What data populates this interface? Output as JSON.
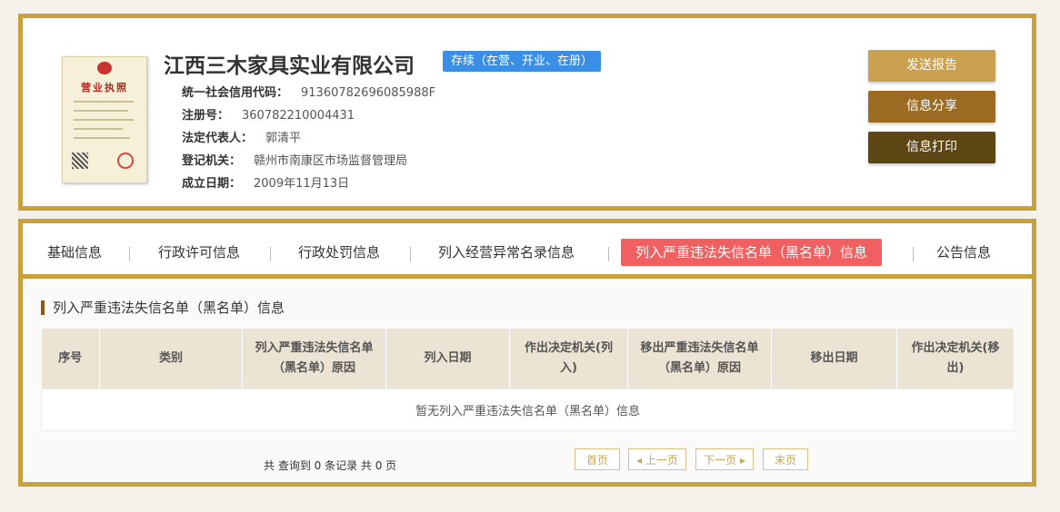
{
  "company": {
    "name": "江西三木家具实业有限公司",
    "status": "存续（在营、开业、在册）",
    "license_title": "营业执照",
    "info": [
      {
        "label": "统一社会信用代码：",
        "value": "91360782696085988F"
      },
      {
        "label": "注册号：",
        "value": "360782210004431"
      },
      {
        "label": "法定代表人：",
        "value": "郭清平"
      },
      {
        "label": "登记机关：",
        "value": "赣州市南康区市场监督管理局"
      },
      {
        "label": "成立日期：",
        "value": "2009年11月13日"
      }
    ]
  },
  "actions": {
    "send_report": "发送报告",
    "share": "信息分享",
    "print": "信息打印",
    "colors": [
      "#c9a150",
      "#9b6b24",
      "#5e4514"
    ]
  },
  "tabs": [
    {
      "label": "基础信息"
    },
    {
      "label": "行政许可信息"
    },
    {
      "label": "行政处罚信息"
    },
    {
      "label": "列入经营异常名录信息"
    },
    {
      "label": "列入严重违法失信名单（黑名单）信息",
      "active": true
    },
    {
      "label": "公告信息"
    }
  ],
  "section": {
    "title": "列入严重违法失信名单（黑名单）信息",
    "columns": [
      "序号",
      "类别",
      "列入严重违法失信名单（黑名单）原因",
      "列入日期",
      "作出决定机关(列入)",
      "移出严重违法失信名单（黑名单）原因",
      "移出日期",
      "作出决定机关(移出)"
    ],
    "empty_text": "暂无列入严重违法失信名单（黑名单）信息"
  },
  "pager": {
    "summary": "共 查询到 0 条记录 共 0 页",
    "first": "首页",
    "prev": "上一页",
    "next": "下一页",
    "last": "末页"
  },
  "theme": {
    "border": "#c9a13b",
    "active_tab": "#f06060",
    "badge": "#3a8ee6"
  }
}
